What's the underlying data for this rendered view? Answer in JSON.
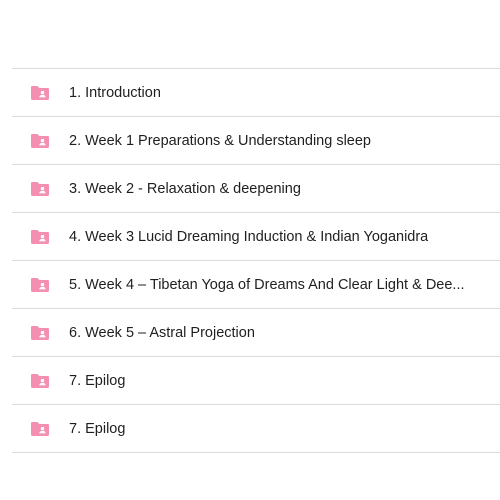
{
  "colors": {
    "folder_icon": "#f48fb1",
    "divider": "#dadce0",
    "text": "#1f1f1f"
  },
  "folders": [
    {
      "label": "1. Introduction",
      "icon": "shared-folder-icon"
    },
    {
      "label": "2. Week 1 Preparations & Understanding sleep",
      "icon": "shared-folder-icon"
    },
    {
      "label": "3. Week 2 - Relaxation & deepening",
      "icon": "shared-folder-icon"
    },
    {
      "label": "4. Week 3 Lucid Dreaming Induction & Indian Yoganidra",
      "icon": "shared-folder-icon"
    },
    {
      "label": "5. Week 4 – Tibetan Yoga of Dreams And Clear Light & Dee...",
      "icon": "shared-folder-icon"
    },
    {
      "label": "6. Week 5 – Astral Projection",
      "icon": "shared-folder-icon"
    },
    {
      "label": "7. Epilog",
      "icon": "shared-folder-icon"
    },
    {
      "label": "7. Epilog",
      "icon": "shared-folder-icon"
    }
  ]
}
